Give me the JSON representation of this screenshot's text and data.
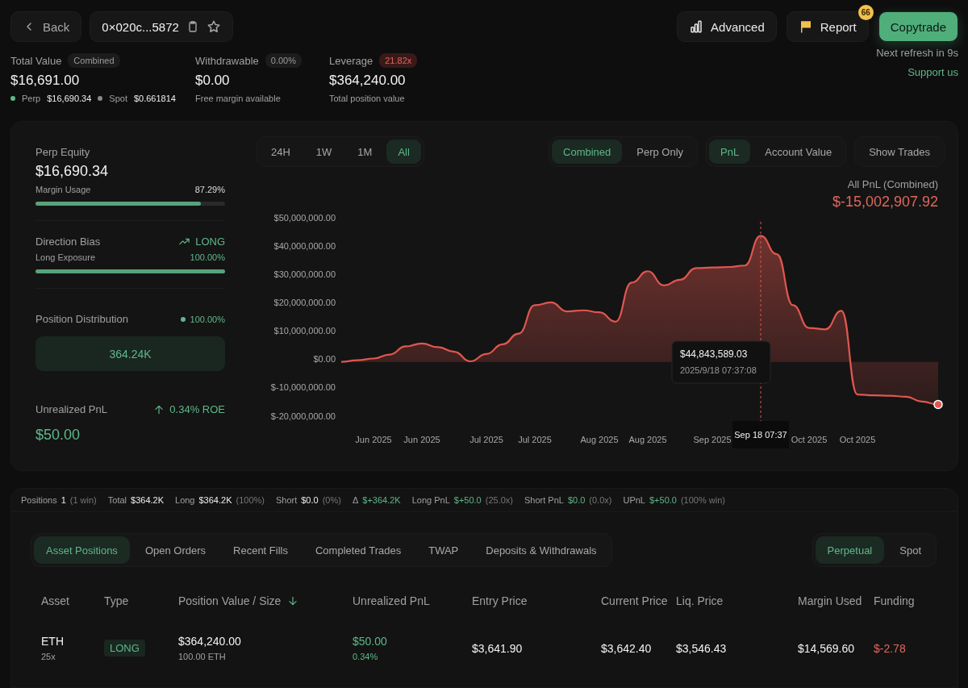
{
  "header": {
    "back": "Back",
    "address": "0×020c...5872",
    "buttons": [
      {
        "kind": "advanced",
        "label": "Advanced"
      },
      {
        "kind": "report",
        "label": "Report",
        "badge": "66"
      },
      {
        "kind": "primary",
        "label": "Copytrade"
      }
    ],
    "refresh": "Next refresh in 9s",
    "support": "Support us"
  },
  "summary": [
    {
      "label": "Total Value",
      "tag": "Combined",
      "alert": false,
      "value": "$16,691.00",
      "breakdown": [
        {
          "label": "Perp",
          "value": "$16,690.34",
          "color": "#5fb88a"
        },
        {
          "label": "Spot",
          "value": "$0.661814",
          "color": "#8a8a8a"
        }
      ]
    },
    {
      "label": "Withdrawable",
      "tag": "0.00%",
      "alert": false,
      "value": "$0.00",
      "note": "Free margin available"
    },
    {
      "label": "Leverage",
      "tag": "21.82x",
      "alert": true,
      "value": "$364,240.00",
      "note": "Total position value"
    }
  ],
  "account": {
    "perp_equity": {
      "label": "Perp Equity",
      "value": "$16,690.34",
      "meter_label": "Margin Usage",
      "reading": "87.29%",
      "level": 0.8729
    },
    "direction": {
      "label": "Direction Bias",
      "bias": "LONG",
      "meter_label": "Long Exposure",
      "reading": "100.00%",
      "level": 1.0
    },
    "distribution": {
      "label": "Position Distribution",
      "share": "100.00%",
      "bar": "364.24K"
    },
    "unrealized": {
      "label": "Unrealized PnL",
      "roe": "0.34% ROE",
      "value": "$50.00"
    }
  },
  "chart": {
    "ranges": [
      {
        "label": "24H",
        "selected": false
      },
      {
        "label": "1W",
        "selected": false
      },
      {
        "label": "1M",
        "selected": false
      },
      {
        "label": "All",
        "selected": true
      }
    ],
    "scopes": [
      {
        "label": "Combined",
        "selected": true
      },
      {
        "label": "Perp Only",
        "selected": false
      }
    ],
    "metrics": [
      {
        "label": "PnL",
        "selected": true
      },
      {
        "label": "Account Value",
        "selected": false
      }
    ],
    "show_trades": "Show Trades",
    "title": "All PnL (Combined)",
    "total": "$-15,002,907.92",
    "tooltip": {
      "value": "$44,843,589.03",
      "time": "2025/9/18 07:37:08"
    },
    "crosshair_label": "Sep 18 07:37",
    "chart_data": {
      "type": "area",
      "ylim": [
        -20000000,
        50000000
      ],
      "yticks": [
        {
          "value": 50000000,
          "label": "$50,000,000.00"
        },
        {
          "value": 40000000,
          "label": "$40,000,000.00"
        },
        {
          "value": 30000000,
          "label": "$30,000,000.00"
        },
        {
          "value": 20000000,
          "label": "$20,000,000.00"
        },
        {
          "value": 10000000,
          "label": "$10,000,000.00"
        },
        {
          "value": 0,
          "label": "$0.00"
        },
        {
          "value": -10000000,
          "label": "$-10,000,000.00"
        },
        {
          "value": -20000000,
          "label": "$-20,000,000.00"
        }
      ],
      "categories": [
        null,
        null,
        "Jun 2025",
        null,
        null,
        "Jun 2025",
        null,
        null,
        null,
        "Jul 2025",
        null,
        null,
        "Jul 2025",
        null,
        null,
        null,
        "Aug 2025",
        null,
        null,
        "Aug 2025",
        null,
        null,
        null,
        "Sep 2025",
        null,
        null,
        null,
        null,
        null,
        "Oct 2025",
        null,
        null,
        "Oct 2025",
        null,
        null,
        null,
        null,
        null
      ],
      "series": [
        {
          "color": "#e0574f",
          "values": [
            0,
            600000,
            1200000,
            2600000,
            5500000,
            6500000,
            5200000,
            3600000,
            200000,
            2800000,
            6200000,
            10000000,
            20000000,
            21000000,
            17800000,
            18200000,
            17500000,
            14200000,
            28000000,
            32000000,
            27000000,
            29000000,
            33100000,
            33300000,
            33500000,
            34000000,
            44500000,
            38000000,
            20000000,
            12000000,
            11500000,
            18000000,
            -11500000,
            -11800000,
            -11900000,
            -12300000,
            -14000000,
            -15000000
          ]
        }
      ]
    }
  },
  "stats": [
    {
      "label": "Positions",
      "value": "1",
      "note": "(1 win)",
      "positive": false
    },
    {
      "label": "Total",
      "value": "$364.2K",
      "positive": false
    },
    {
      "label": "Long",
      "value": "$364.2K",
      "note": "(100%)",
      "positive": false
    },
    {
      "label": "Short",
      "value": "$0.0",
      "note": "(0%)",
      "positive": false
    },
    {
      "label": "Δ",
      "value": "$+364.2K",
      "positive": true
    },
    {
      "label": "Long PnL",
      "value": "$+50.0",
      "note": "(25.0x)",
      "positive": true
    },
    {
      "label": "Short PnL",
      "value": "$0.0",
      "note": "(0.0x)",
      "positive": true
    },
    {
      "label": "UPnL",
      "value": "$+50.0",
      "note": "(100% win)",
      "positive": true
    }
  ],
  "tabs": [
    {
      "label": "Asset Positions",
      "selected": true
    },
    {
      "label": "Open Orders",
      "selected": false
    },
    {
      "label": "Recent Fills",
      "selected": false
    },
    {
      "label": "Completed Trades",
      "selected": false
    },
    {
      "label": "TWAP",
      "selected": false
    },
    {
      "label": "Deposits & Withdrawals",
      "selected": false
    }
  ],
  "markets": [
    {
      "label": "Perpetual",
      "selected": true
    },
    {
      "label": "Spot",
      "selected": false
    }
  ],
  "table": {
    "columns": [
      {
        "label": "Asset",
        "sorted": false
      },
      {
        "label": "Type",
        "sorted": false
      },
      {
        "label": "Position Value / Size",
        "sorted": true
      },
      {
        "label": "Unrealized PnL",
        "sorted": false
      },
      {
        "label": "Entry Price",
        "sorted": false
      },
      {
        "label": "Current Price",
        "sorted": false
      },
      {
        "label": "Liq. Price",
        "sorted": false
      },
      {
        "label": "Margin Used",
        "sorted": false
      },
      {
        "label": "Funding",
        "sorted": false
      }
    ],
    "rows": [
      {
        "asset": "ETH",
        "leverage": "25x",
        "type": "LONG",
        "position_value": "$364,240.00",
        "size": "100.00 ETH",
        "upnl": "$50.00",
        "upnl_pct": "0.34%",
        "upnl_positive": true,
        "entry": "$3,641.90",
        "current": "$3,642.40",
        "liq": "$3,546.43",
        "margin": "$14,569.60",
        "funding": "$-2.78",
        "funding_negative": true
      }
    ]
  }
}
